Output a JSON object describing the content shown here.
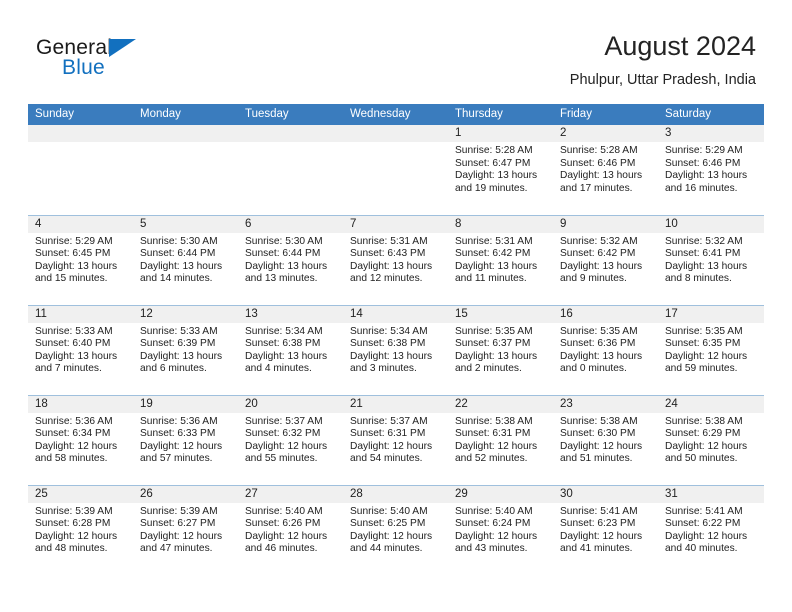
{
  "brand": {
    "name_part1": "General",
    "name_part2": "Blue",
    "flag_icon": "triangle-flag-icon",
    "accent_color": "#1270bf"
  },
  "header": {
    "title": "August 2024",
    "subtitle": "Phulpur, Uttar Pradesh, India"
  },
  "theme": {
    "header_band": "#3a7cbe",
    "daynum_band": "#f0f0f0",
    "row_rule": "#9fc0dd"
  },
  "weekdays": [
    "Sunday",
    "Monday",
    "Tuesday",
    "Wednesday",
    "Thursday",
    "Friday",
    "Saturday"
  ],
  "weeks": [
    [
      {
        "day": "",
        "empty": true
      },
      {
        "day": "",
        "empty": true
      },
      {
        "day": "",
        "empty": true
      },
      {
        "day": "",
        "empty": true
      },
      {
        "day": "1",
        "sunrise": "Sunrise: 5:28 AM",
        "sunset": "Sunset: 6:47 PM",
        "daylight1": "Daylight: 13 hours",
        "daylight2": "and 19 minutes."
      },
      {
        "day": "2",
        "sunrise": "Sunrise: 5:28 AM",
        "sunset": "Sunset: 6:46 PM",
        "daylight1": "Daylight: 13 hours",
        "daylight2": "and 17 minutes."
      },
      {
        "day": "3",
        "sunrise": "Sunrise: 5:29 AM",
        "sunset": "Sunset: 6:46 PM",
        "daylight1": "Daylight: 13 hours",
        "daylight2": "and 16 minutes."
      }
    ],
    [
      {
        "day": "4",
        "sunrise": "Sunrise: 5:29 AM",
        "sunset": "Sunset: 6:45 PM",
        "daylight1": "Daylight: 13 hours",
        "daylight2": "and 15 minutes."
      },
      {
        "day": "5",
        "sunrise": "Sunrise: 5:30 AM",
        "sunset": "Sunset: 6:44 PM",
        "daylight1": "Daylight: 13 hours",
        "daylight2": "and 14 minutes."
      },
      {
        "day": "6",
        "sunrise": "Sunrise: 5:30 AM",
        "sunset": "Sunset: 6:44 PM",
        "daylight1": "Daylight: 13 hours",
        "daylight2": "and 13 minutes."
      },
      {
        "day": "7",
        "sunrise": "Sunrise: 5:31 AM",
        "sunset": "Sunset: 6:43 PM",
        "daylight1": "Daylight: 13 hours",
        "daylight2": "and 12 minutes."
      },
      {
        "day": "8",
        "sunrise": "Sunrise: 5:31 AM",
        "sunset": "Sunset: 6:42 PM",
        "daylight1": "Daylight: 13 hours",
        "daylight2": "and 11 minutes."
      },
      {
        "day": "9",
        "sunrise": "Sunrise: 5:32 AM",
        "sunset": "Sunset: 6:42 PM",
        "daylight1": "Daylight: 13 hours",
        "daylight2": "and 9 minutes."
      },
      {
        "day": "10",
        "sunrise": "Sunrise: 5:32 AM",
        "sunset": "Sunset: 6:41 PM",
        "daylight1": "Daylight: 13 hours",
        "daylight2": "and 8 minutes."
      }
    ],
    [
      {
        "day": "11",
        "sunrise": "Sunrise: 5:33 AM",
        "sunset": "Sunset: 6:40 PM",
        "daylight1": "Daylight: 13 hours",
        "daylight2": "and 7 minutes."
      },
      {
        "day": "12",
        "sunrise": "Sunrise: 5:33 AM",
        "sunset": "Sunset: 6:39 PM",
        "daylight1": "Daylight: 13 hours",
        "daylight2": "and 6 minutes."
      },
      {
        "day": "13",
        "sunrise": "Sunrise: 5:34 AM",
        "sunset": "Sunset: 6:38 PM",
        "daylight1": "Daylight: 13 hours",
        "daylight2": "and 4 minutes."
      },
      {
        "day": "14",
        "sunrise": "Sunrise: 5:34 AM",
        "sunset": "Sunset: 6:38 PM",
        "daylight1": "Daylight: 13 hours",
        "daylight2": "and 3 minutes."
      },
      {
        "day": "15",
        "sunrise": "Sunrise: 5:35 AM",
        "sunset": "Sunset: 6:37 PM",
        "daylight1": "Daylight: 13 hours",
        "daylight2": "and 2 minutes."
      },
      {
        "day": "16",
        "sunrise": "Sunrise: 5:35 AM",
        "sunset": "Sunset: 6:36 PM",
        "daylight1": "Daylight: 13 hours",
        "daylight2": "and 0 minutes."
      },
      {
        "day": "17",
        "sunrise": "Sunrise: 5:35 AM",
        "sunset": "Sunset: 6:35 PM",
        "daylight1": "Daylight: 12 hours",
        "daylight2": "and 59 minutes."
      }
    ],
    [
      {
        "day": "18",
        "sunrise": "Sunrise: 5:36 AM",
        "sunset": "Sunset: 6:34 PM",
        "daylight1": "Daylight: 12 hours",
        "daylight2": "and 58 minutes."
      },
      {
        "day": "19",
        "sunrise": "Sunrise: 5:36 AM",
        "sunset": "Sunset: 6:33 PM",
        "daylight1": "Daylight: 12 hours",
        "daylight2": "and 57 minutes."
      },
      {
        "day": "20",
        "sunrise": "Sunrise: 5:37 AM",
        "sunset": "Sunset: 6:32 PM",
        "daylight1": "Daylight: 12 hours",
        "daylight2": "and 55 minutes."
      },
      {
        "day": "21",
        "sunrise": "Sunrise: 5:37 AM",
        "sunset": "Sunset: 6:31 PM",
        "daylight1": "Daylight: 12 hours",
        "daylight2": "and 54 minutes."
      },
      {
        "day": "22",
        "sunrise": "Sunrise: 5:38 AM",
        "sunset": "Sunset: 6:31 PM",
        "daylight1": "Daylight: 12 hours",
        "daylight2": "and 52 minutes."
      },
      {
        "day": "23",
        "sunrise": "Sunrise: 5:38 AM",
        "sunset": "Sunset: 6:30 PM",
        "daylight1": "Daylight: 12 hours",
        "daylight2": "and 51 minutes."
      },
      {
        "day": "24",
        "sunrise": "Sunrise: 5:38 AM",
        "sunset": "Sunset: 6:29 PM",
        "daylight1": "Daylight: 12 hours",
        "daylight2": "and 50 minutes."
      }
    ],
    [
      {
        "day": "25",
        "sunrise": "Sunrise: 5:39 AM",
        "sunset": "Sunset: 6:28 PM",
        "daylight1": "Daylight: 12 hours",
        "daylight2": "and 48 minutes."
      },
      {
        "day": "26",
        "sunrise": "Sunrise: 5:39 AM",
        "sunset": "Sunset: 6:27 PM",
        "daylight1": "Daylight: 12 hours",
        "daylight2": "and 47 minutes."
      },
      {
        "day": "27",
        "sunrise": "Sunrise: 5:40 AM",
        "sunset": "Sunset: 6:26 PM",
        "daylight1": "Daylight: 12 hours",
        "daylight2": "and 46 minutes."
      },
      {
        "day": "28",
        "sunrise": "Sunrise: 5:40 AM",
        "sunset": "Sunset: 6:25 PM",
        "daylight1": "Daylight: 12 hours",
        "daylight2": "and 44 minutes."
      },
      {
        "day": "29",
        "sunrise": "Sunrise: 5:40 AM",
        "sunset": "Sunset: 6:24 PM",
        "daylight1": "Daylight: 12 hours",
        "daylight2": "and 43 minutes."
      },
      {
        "day": "30",
        "sunrise": "Sunrise: 5:41 AM",
        "sunset": "Sunset: 6:23 PM",
        "daylight1": "Daylight: 12 hours",
        "daylight2": "and 41 minutes."
      },
      {
        "day": "31",
        "sunrise": "Sunrise: 5:41 AM",
        "sunset": "Sunset: 6:22 PM",
        "daylight1": "Daylight: 12 hours",
        "daylight2": "and 40 minutes."
      }
    ]
  ]
}
